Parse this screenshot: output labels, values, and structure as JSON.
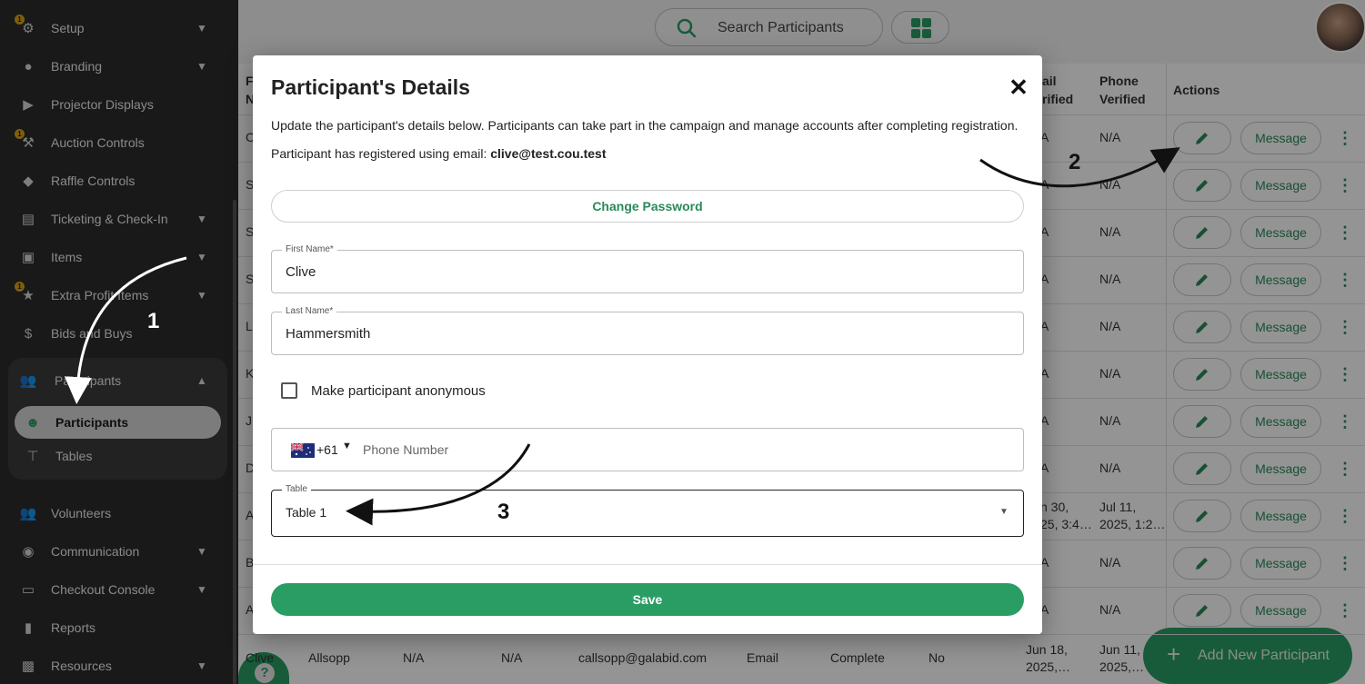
{
  "sidebar": {
    "items": [
      {
        "label": "Setup",
        "icon": "gear-icon",
        "badge": "1",
        "chevron": "down"
      },
      {
        "label": "Branding",
        "icon": "palette-icon",
        "chevron": "down"
      },
      {
        "label": "Projector Displays",
        "icon": "projector-icon"
      },
      {
        "label": "Auction Controls",
        "icon": "gavel-icon",
        "badge": "1"
      },
      {
        "label": "Raffle Controls",
        "icon": "ticket-icon"
      },
      {
        "label": "Ticketing & Check-In",
        "icon": "ticket-icon",
        "chevron": "down"
      },
      {
        "label": "Items",
        "icon": "inbox-icon",
        "chevron": "down"
      },
      {
        "label": "Extra Profit Items",
        "icon": "star-icon",
        "badge": "1",
        "chevron": "down"
      },
      {
        "label": "Bids and Buys",
        "icon": "dollar-icon"
      }
    ],
    "group": {
      "label": "Participants",
      "icon": "people-icon",
      "children": [
        {
          "label": "Participants",
          "icon": "faces-icon",
          "active": true
        },
        {
          "label": "Tables",
          "icon": "table-icon"
        }
      ]
    },
    "items_after": [
      {
        "label": "Volunteers",
        "icon": "people-icon"
      },
      {
        "label": "Communication",
        "icon": "broadcast-icon",
        "chevron": "down"
      },
      {
        "label": "Checkout Console",
        "icon": "card-icon",
        "chevron": "down"
      },
      {
        "label": "Reports",
        "icon": "document-icon"
      },
      {
        "label": "Resources",
        "icon": "resource-icon",
        "chevron": "down"
      }
    ]
  },
  "topbar": {
    "search_placeholder": "Search Participants"
  },
  "table": {
    "headers": {
      "first_name_partial": "F\nN",
      "email_verified_partial": "ail\nrified",
      "phone_verified": "Phone\nVerified",
      "actions": "Actions"
    },
    "rows": [
      {
        "first": "C",
        "email_v": "A",
        "phone_v": "N/A"
      },
      {
        "first": "S",
        "email_v": "A",
        "phone_v": "N/A"
      },
      {
        "first": "S",
        "email_v": "A",
        "phone_v": "N/A"
      },
      {
        "first": "S",
        "email_v": "A",
        "phone_v": "N/A"
      },
      {
        "first": "L",
        "email_v": "A",
        "phone_v": "N/A"
      },
      {
        "first": "K",
        "email_v": "A",
        "phone_v": "N/A"
      },
      {
        "first": "J",
        "email_v": "A",
        "phone_v": "N/A"
      },
      {
        "first": "D",
        "email_v": "A",
        "phone_v": "N/A"
      },
      {
        "first": "A",
        "email_v": "n 30,\n25, 3:4…",
        "phone_v": "Jul 11,\n2025, 1:2…"
      },
      {
        "first": "B",
        "email_v": "A",
        "phone_v": "N/A"
      },
      {
        "first": "A",
        "email_v": "A",
        "phone_v": "N/A"
      }
    ],
    "last_row": {
      "first": "Clive",
      "last": "Allsopp",
      "col3": "N/A",
      "col4": "N/A",
      "email": "callsopp@galabid.com",
      "method": "Email",
      "status": "Complete",
      "anon": "No",
      "email_v": "Jun 18,\n2025,…",
      "phone_v": "Jun 11,\n2025,…"
    },
    "message_label": "Message"
  },
  "modal": {
    "title": "Participant's Details",
    "description": "Update the participant's details below. Participants can take part in the campaign and manage accounts after completing registration.",
    "registered_prefix": "Participant has registered using email: ",
    "registered_email": "clive@test.cou.test",
    "change_password_label": "Change Password",
    "first_name_label": "First Name*",
    "first_name_value": "Clive",
    "last_name_label": "Last Name*",
    "last_name_value": "Hammersmith",
    "anonymous_label": "Make participant anonymous",
    "anonymous_checked": false,
    "phone_country_code": "+61",
    "phone_placeholder": "Phone Number",
    "table_label": "Table",
    "table_value": "Table 1",
    "save_label": "Save"
  },
  "fab": {
    "label": "Add New Participant"
  },
  "help": {
    "label": "?"
  },
  "annotations": [
    "1",
    "2",
    "3"
  ],
  "colors": {
    "accent": "#2a9d64",
    "sidebar": "#2c2c2c",
    "link": "#2a8a5a",
    "badge": "#d9a21b"
  }
}
